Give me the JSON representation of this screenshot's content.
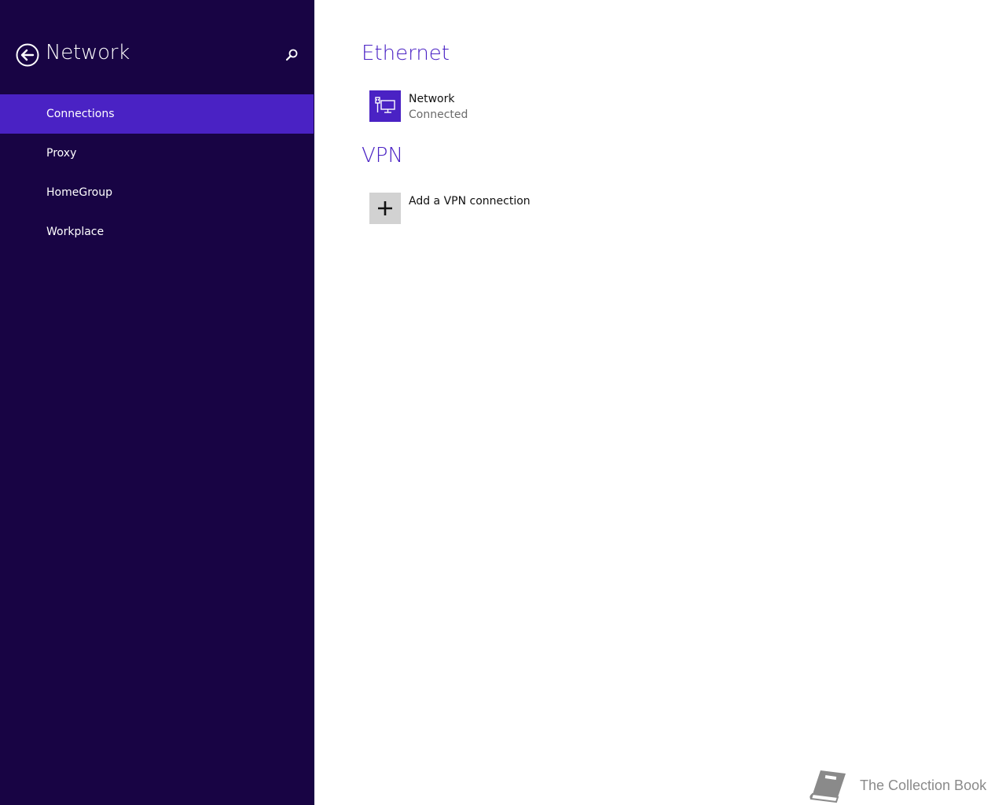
{
  "sidebar": {
    "title": "Network",
    "back_icon": "back-arrow-circle-icon",
    "search_icon": "search-icon",
    "items": [
      {
        "label": "Connections",
        "selected": true
      },
      {
        "label": "Proxy",
        "selected": false
      },
      {
        "label": "HomeGroup",
        "selected": false
      },
      {
        "label": "Workplace",
        "selected": false
      }
    ]
  },
  "main": {
    "ethernet": {
      "title": "Ethernet",
      "connection": {
        "name": "Network",
        "status": "Connected",
        "icon": "ethernet-icon"
      }
    },
    "vpn": {
      "title": "VPN",
      "add_label": "Add a VPN connection",
      "icon": "plus-icon"
    }
  },
  "watermark": {
    "text": "The Collection Book",
    "icon": "book-icon"
  },
  "colors": {
    "sidebar_bg": "#180444",
    "accent": "#4a22c4",
    "plus_tile_bg": "#d2d2d2"
  }
}
